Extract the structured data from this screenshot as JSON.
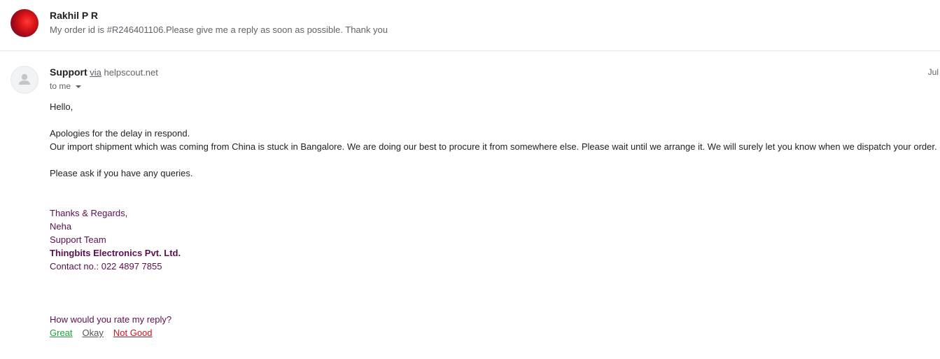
{
  "previous_message": {
    "sender": "Rakhil P R",
    "snippet": "My order id is #R246401106.Please give me a reply as soon as possible. Thank you"
  },
  "message": {
    "from_name": "Support",
    "via_label": "via",
    "via_domain": "helpscout.net",
    "date": "Jul",
    "to_label": "to me",
    "greeting": "Hello,",
    "line1": "Apologies for the delay in respond.",
    "line2": "Our import shipment which was coming from China is stuck in Bangalore. We are doing our best to procure it from somewhere else. Please wait until we arrange it. We will surely let you know when we dispatch your order.",
    "line3": "Please ask if you have any queries.",
    "signature": {
      "closing": "Thanks & Regards,",
      "name": "Neha",
      "team": "Support Team",
      "company": "Thingbits Electronics Pvt. Ltd.",
      "contact": "Contact no.: 022 4897 7855"
    },
    "rating": {
      "question": "How would you rate my reply?",
      "great": "Great",
      "okay": "Okay",
      "not_good": "Not Good"
    }
  },
  "colors": {
    "signature": "#5b0f4f",
    "great": "#1aa33c",
    "okay": "#555555",
    "not_good": "#d9101b"
  }
}
